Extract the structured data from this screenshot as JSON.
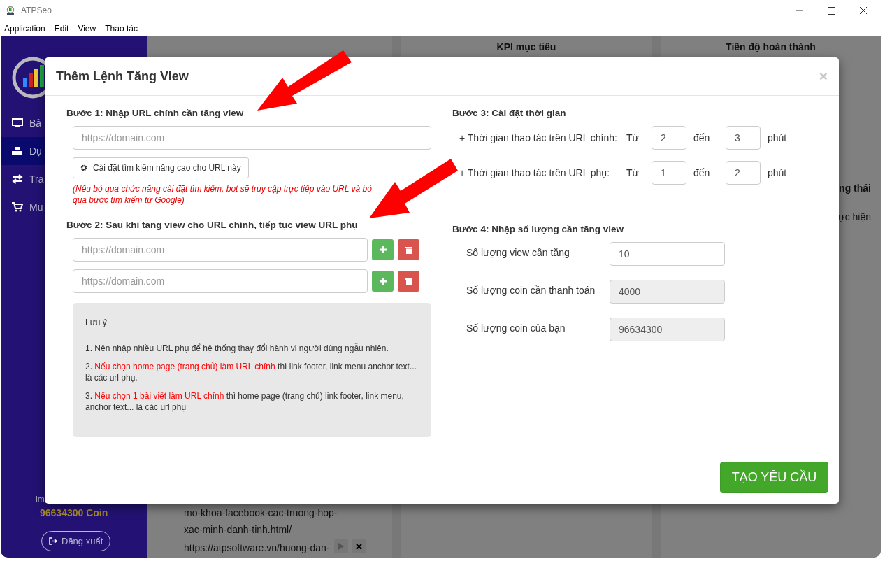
{
  "window": {
    "title": "ATPSeo"
  },
  "menu": [
    "Application",
    "Edit",
    "View",
    "Thao tác"
  ],
  "sidebar": {
    "items": [
      {
        "label": "Bả",
        "selected": false
      },
      {
        "label": "Dụ",
        "selected": true
      },
      {
        "label": "Tra",
        "selected": false
      },
      {
        "label": "Mu",
        "selected": false
      }
    ],
    "user": "im",
    "coins": "96634300 Coin",
    "logout": "Đăng xuất"
  },
  "background": {
    "headers": [
      "KPI mục tiêu",
      "Tiến độ hoàn thành"
    ],
    "column_3": "ng thái",
    "cell": "ực hiện",
    "urls": [
      {
        "lines": [
          "mo-khoa-facebook-cac-truong-hop-",
          "xac-minh-danh-tinh.html/"
        ]
      },
      {
        "lines": [
          "https://atpsoftware.vn/huong-dan-"
        ]
      }
    ]
  },
  "dialog": {
    "title": "Thêm Lệnh Tăng View",
    "close": "×",
    "step1": {
      "heading": "Bước 1: Nhập URL chính cần tăng view",
      "placeholder": "https://domain.com",
      "advanced_button": "Cài đặt tìm kiếm nâng cao cho URL này",
      "hint": "(Nếu bỏ qua chức năng cài đặt tìm kiếm, bot sẽ truy cập trực tiếp vào URL và bỏ qua bước tìm kiếm từ Google)"
    },
    "step2": {
      "heading": "Bước 2: Sau khi tăng view cho URL chính, tiếp tục view URL phụ",
      "sub_urls": [
        {
          "placeholder": "https://domain.com"
        },
        {
          "placeholder": "https://domain.com"
        }
      ]
    },
    "note": {
      "title": "Lưu ý",
      "items": [
        {
          "number": "1.",
          "text": "Nên nhập nhiều URL phụ để hệ thống thay đổi hành vi người dùng ngẫu nhiên."
        },
        {
          "number": "2.",
          "highlight": "Nếu chọn home page (trang chủ) làm URL chính",
          "text": "thì link footer, link menu anchor text... là các url phụ."
        },
        {
          "number": "3.",
          "highlight": "Nếu chọn 1 bài viết làm URL chính",
          "text": "thì home page (trang chủ) link footer, link menu, anchor text... là các url phụ"
        }
      ]
    },
    "step3": {
      "heading": "Bước 3: Cài đặt thời gian",
      "rows": [
        {
          "label": "+ Thời gian thao tác trên URL chính:",
          "from_label": "Từ",
          "from": "2",
          "to_label": "đến",
          "to": "3",
          "unit": "phút"
        },
        {
          "label": "+ Thời gian thao tác trên URL phụ:",
          "from_label": "Từ",
          "from": "1",
          "to_label": "đến",
          "to": "2",
          "unit": "phút"
        }
      ]
    },
    "step4": {
      "heading": "Bước 4: Nhập số lượng cần tăng view",
      "fields": [
        {
          "label": "Số lượng view cần tăng",
          "value": "10",
          "disabled": false
        },
        {
          "label": "Số lượng coin cần thanh toán",
          "value": "4000",
          "disabled": true
        },
        {
          "label": "Số lượng coin của bạn",
          "value": "96634300",
          "disabled": true
        }
      ]
    },
    "submit": "TẠO YÊU CẦU"
  }
}
